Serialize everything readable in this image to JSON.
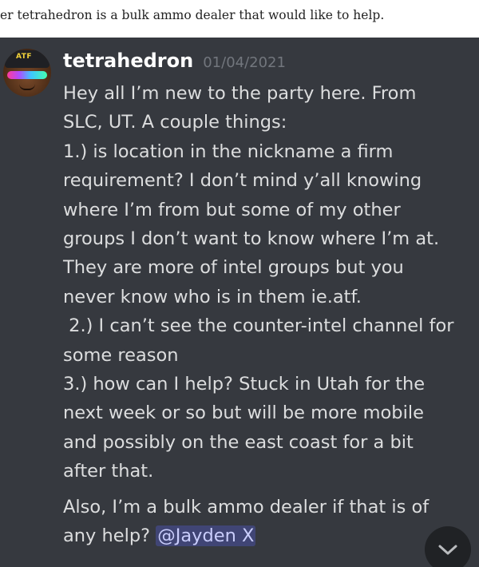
{
  "caption": "er tetrahedron is a bulk ammo dealer that would like to help.",
  "message": {
    "avatar_text": "ATF",
    "username": "tetrahedron",
    "timestamp": "01/04/2021",
    "lines": [
      "Hey all I’m new to the party here. From",
      "SLC, UT. A couple things:",
      "1.) is location in the nickname a firm",
      "requirement? I don’t mind y’all knowing",
      "where I’m from but some of my other",
      "groups I don’t want to know where I’m at.",
      "They are more of intel groups but you",
      "never know who is in them ie.atf.",
      " 2.) I can’t see the counter-intel channel for",
      "some reason",
      "3.) how can I help? Stuck in Utah for the",
      "next week or so but will be more mobile",
      "and possibly on the east coast for a bit",
      "after that."
    ],
    "second_paragraph": {
      "line1": "Also, I’m a bulk ammo dealer if that is of",
      "line2_prefix": "any help? ",
      "mention": "@Jayden X"
    }
  },
  "icons": {
    "scroll_down": "chevron-down-icon"
  },
  "colors": {
    "panel_background": "#36393f",
    "username": "#ffffff",
    "timestamp": "#72767d",
    "message_text": "#dcddde",
    "mention_text": "#c9cdfb"
  }
}
